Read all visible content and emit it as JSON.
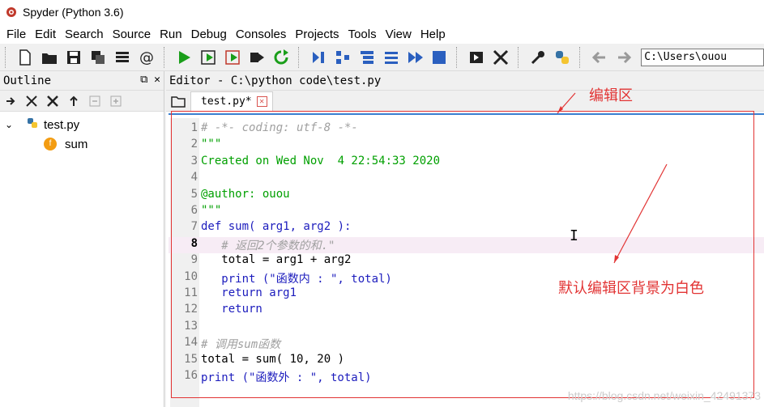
{
  "window": {
    "title": "Spyder (Python 3.6)"
  },
  "menu": [
    "File",
    "Edit",
    "Search",
    "Source",
    "Run",
    "Debug",
    "Consoles",
    "Projects",
    "Tools",
    "View",
    "Help"
  ],
  "toolbar": {
    "path_value": "C:\\Users\\ouou",
    "icons": [
      "new-file-icon",
      "open-folder-icon",
      "save-icon",
      "save-all-icon",
      "list-icon",
      "at-icon",
      "run-icon",
      "run-cell-icon",
      "run-cell-advance-icon",
      "run-selection-icon",
      "rerun-icon",
      "debug-step-icon",
      "step-into-icon",
      "step-return-icon",
      "continue-icon",
      "stop-icon",
      "maximize-pane-icon",
      "fullscreen-icon",
      "wrench-icon",
      "python-icon",
      "back-arrow-icon",
      "forward-arrow-icon"
    ]
  },
  "outline": {
    "header": "Outline",
    "header_controls": "⧉ ✕",
    "tree": [
      {
        "label": "test.py",
        "type": "file"
      },
      {
        "label": "sum",
        "type": "function"
      }
    ]
  },
  "editor": {
    "header": "Editor - C:\\python code\\test.py",
    "tab_label": "test.py*",
    "current_line": 8,
    "lines": [
      "# -*- coding: utf-8 -*-",
      "\"\"\"",
      "Created on Wed Nov  4 22:54:33 2020",
      "",
      "@author: ouou",
      "\"\"\"",
      "def sum( arg1, arg2 ):",
      "   # 返回2个参数的和.\"",
      "   total = arg1 + arg2",
      "   print (\"函数内 : \", total)",
      "   return arg1",
      "   return",
      "",
      "# 调用sum函数",
      "total = sum( 10, 20 )",
      "print (\"函数外 : \", total)"
    ]
  },
  "annotations": {
    "edit_area": "编辑区",
    "default_bg": "默认编辑区背景为白色"
  },
  "watermark": "https://blog.csdn.net/weixin_42491373"
}
